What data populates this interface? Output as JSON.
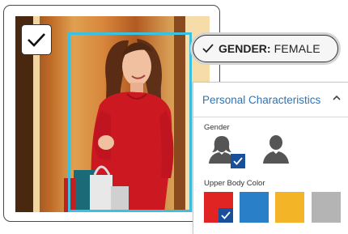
{
  "gender_tag": {
    "key": "GENDER:",
    "value": "FEMALE",
    "icon": "check-icon"
  },
  "panel": {
    "title": "Personal Characteristics",
    "collapse_icon": "chevron-up-icon",
    "gender": {
      "label": "Gender",
      "options": [
        {
          "icon": "female-person-icon",
          "selected": true
        },
        {
          "icon": "male-person-icon",
          "selected": false
        }
      ]
    },
    "upper_body_color": {
      "label": "Upper Body Color",
      "swatches": [
        {
          "color": "#e02424",
          "selected": true
        },
        {
          "color": "#2a80c8",
          "selected": false
        },
        {
          "color": "#f4b428",
          "selected": false
        },
        {
          "color": "#b4b4b4",
          "selected": false
        }
      ]
    }
  },
  "photo": {
    "selected": true,
    "detection_color": "#3cc0e0"
  }
}
